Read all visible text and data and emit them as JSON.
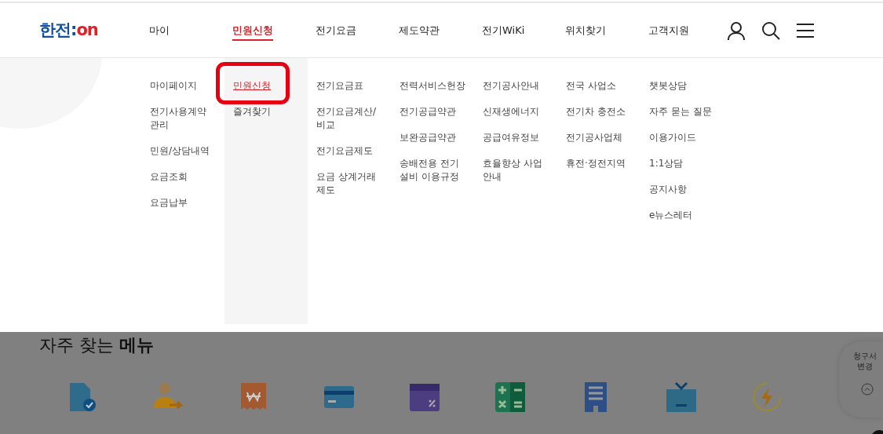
{
  "logo": {
    "text": "한전:",
    "accent": "on"
  },
  "nav": [
    {
      "label": "마이",
      "selected": false
    },
    {
      "label": "민원신청",
      "selected": true
    },
    {
      "label": "전기요금",
      "selected": false
    },
    {
      "label": "제도약관",
      "selected": false
    },
    {
      "label": "전기WiKi",
      "selected": false
    },
    {
      "label": "위치찾기",
      "selected": false
    },
    {
      "label": "고객지원",
      "selected": false
    }
  ],
  "mega_menu": [
    {
      "items": [
        {
          "label": "마이페이지",
          "selected": false,
          "highlighted": false
        },
        {
          "label": "전기사용계약관리",
          "selected": false,
          "highlighted": false
        },
        {
          "label": "민원/상담내역",
          "selected": false,
          "highlighted": false
        },
        {
          "label": "요금조회",
          "selected": false,
          "highlighted": false
        },
        {
          "label": "요금납부",
          "selected": false,
          "highlighted": false
        }
      ]
    },
    {
      "items": [
        {
          "label": "민원신청",
          "selected": true,
          "highlighted": true
        },
        {
          "label": "즐겨찾기",
          "selected": false,
          "highlighted": false
        }
      ]
    },
    {
      "items": [
        {
          "label": "전기요금표",
          "selected": false,
          "highlighted": false
        },
        {
          "label": "전기요금계산/비교",
          "selected": false,
          "highlighted": false
        },
        {
          "label": "전기요금제도",
          "selected": false,
          "highlighted": false
        },
        {
          "label": "요금 상계거래 제도",
          "selected": false,
          "highlighted": false
        }
      ]
    },
    {
      "items": [
        {
          "label": "전력서비스헌장",
          "selected": false,
          "highlighted": false
        },
        {
          "label": "전기공급약관",
          "selected": false,
          "highlighted": false
        },
        {
          "label": "보완공급약관",
          "selected": false,
          "highlighted": false
        },
        {
          "label": "송배전용 전기설비 이용규정",
          "selected": false,
          "highlighted": false
        }
      ]
    },
    {
      "items": [
        {
          "label": "전기공사안내",
          "selected": false,
          "highlighted": false
        },
        {
          "label": "신재생에너지",
          "selected": false,
          "highlighted": false
        },
        {
          "label": "공급여유정보",
          "selected": false,
          "highlighted": false
        },
        {
          "label": "효율향상 사업 안내",
          "selected": false,
          "highlighted": false
        }
      ]
    },
    {
      "items": [
        {
          "label": "전국 사업소",
          "selected": false,
          "highlighted": false
        },
        {
          "label": "전기차 충전소",
          "selected": false,
          "highlighted": false
        },
        {
          "label": "전기공사업체",
          "selected": false,
          "highlighted": false
        },
        {
          "label": "휴전·정전지역",
          "selected": false,
          "highlighted": false
        }
      ]
    },
    {
      "items": [
        {
          "label": "챗봇상담",
          "selected": false,
          "highlighted": false
        },
        {
          "label": "자주 묻는 질문",
          "selected": false,
          "highlighted": false
        },
        {
          "label": "이용가이드",
          "selected": false,
          "highlighted": false
        },
        {
          "label": "1:1상담",
          "selected": false,
          "highlighted": false
        },
        {
          "label": "공지사항",
          "selected": false,
          "highlighted": false
        },
        {
          "label": "e뉴스레터",
          "selected": false,
          "highlighted": false
        }
      ]
    }
  ],
  "quick_menu": {
    "title": "자주 찾는 **메뉴**"
  },
  "side_panel": {
    "label": "청구서 변경"
  }
}
